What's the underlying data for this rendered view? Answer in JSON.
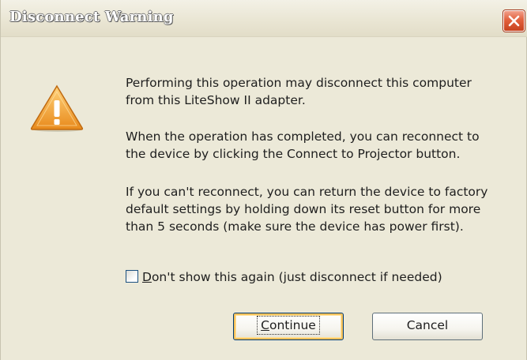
{
  "window": {
    "title": "Disconnect Warning",
    "close_icon": "close-icon",
    "colors": {
      "close_button": "#e2603c",
      "dialog_bg": "#ece9d8",
      "default_button_border": "#003c74"
    }
  },
  "icon": {
    "name": "warning-icon",
    "glyph": "!",
    "color": "#f0a030"
  },
  "messages": {
    "line1": "Performing this operation may disconnect this computer\nfrom this LiteShow II adapter.",
    "line2": "When the operation has completed, you can reconnect to\nthe device by clicking the Connect to Projector button.",
    "line3": "If you can't reconnect, you can return the device to factory\ndefault settings by holding down its reset button for more\nthan 5 seconds (make sure the device has power first)."
  },
  "checkbox": {
    "mnemonic": "D",
    "label_rest": "on't show this again (just disconnect if needed)",
    "checked": false
  },
  "buttons": {
    "continue": {
      "mnemonic": "C",
      "rest": "ontinue",
      "default": true
    },
    "cancel": {
      "label": "Cancel"
    }
  }
}
